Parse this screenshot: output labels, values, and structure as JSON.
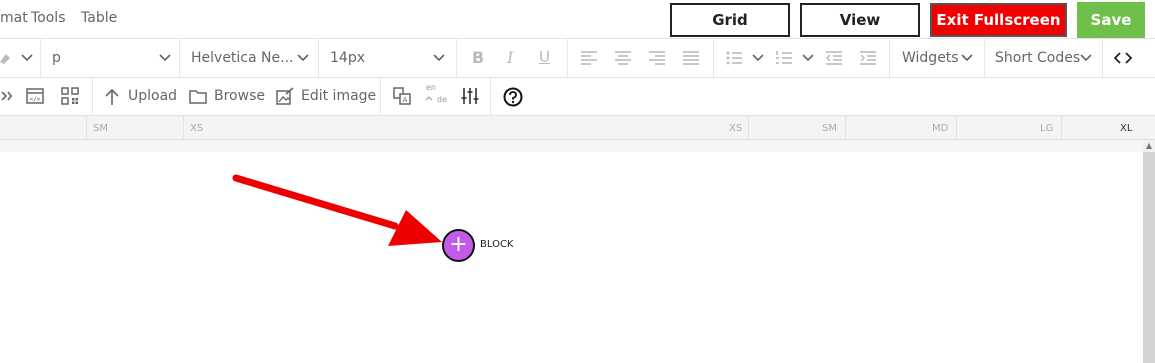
{
  "menubar": {
    "items": [
      "mat",
      "Tools",
      "Table"
    ],
    "buttons": {
      "grid": "Grid",
      "view": "View",
      "exit": "Exit Fullscreen",
      "save": "Save"
    }
  },
  "toolbar": {
    "block_format": "p",
    "font_family": "Helvetica Ne...",
    "font_size": "14px",
    "widgets": "Widgets",
    "short_codes": "Short Codes",
    "upload": "Upload",
    "browse": "Browse",
    "edit_image": "Edit image",
    "lang_from": "en",
    "lang_to": "de"
  },
  "ruler": {
    "labels": [
      "SM",
      "XS",
      "XS",
      "SM",
      "MD",
      "LG",
      "XL"
    ]
  },
  "canvas": {
    "block_label": "BLOCK"
  },
  "colors": {
    "exit_bg": "#f00000",
    "save_bg": "#6fc04a",
    "add_block": "#c35be8",
    "arrow": "#ee0000"
  }
}
